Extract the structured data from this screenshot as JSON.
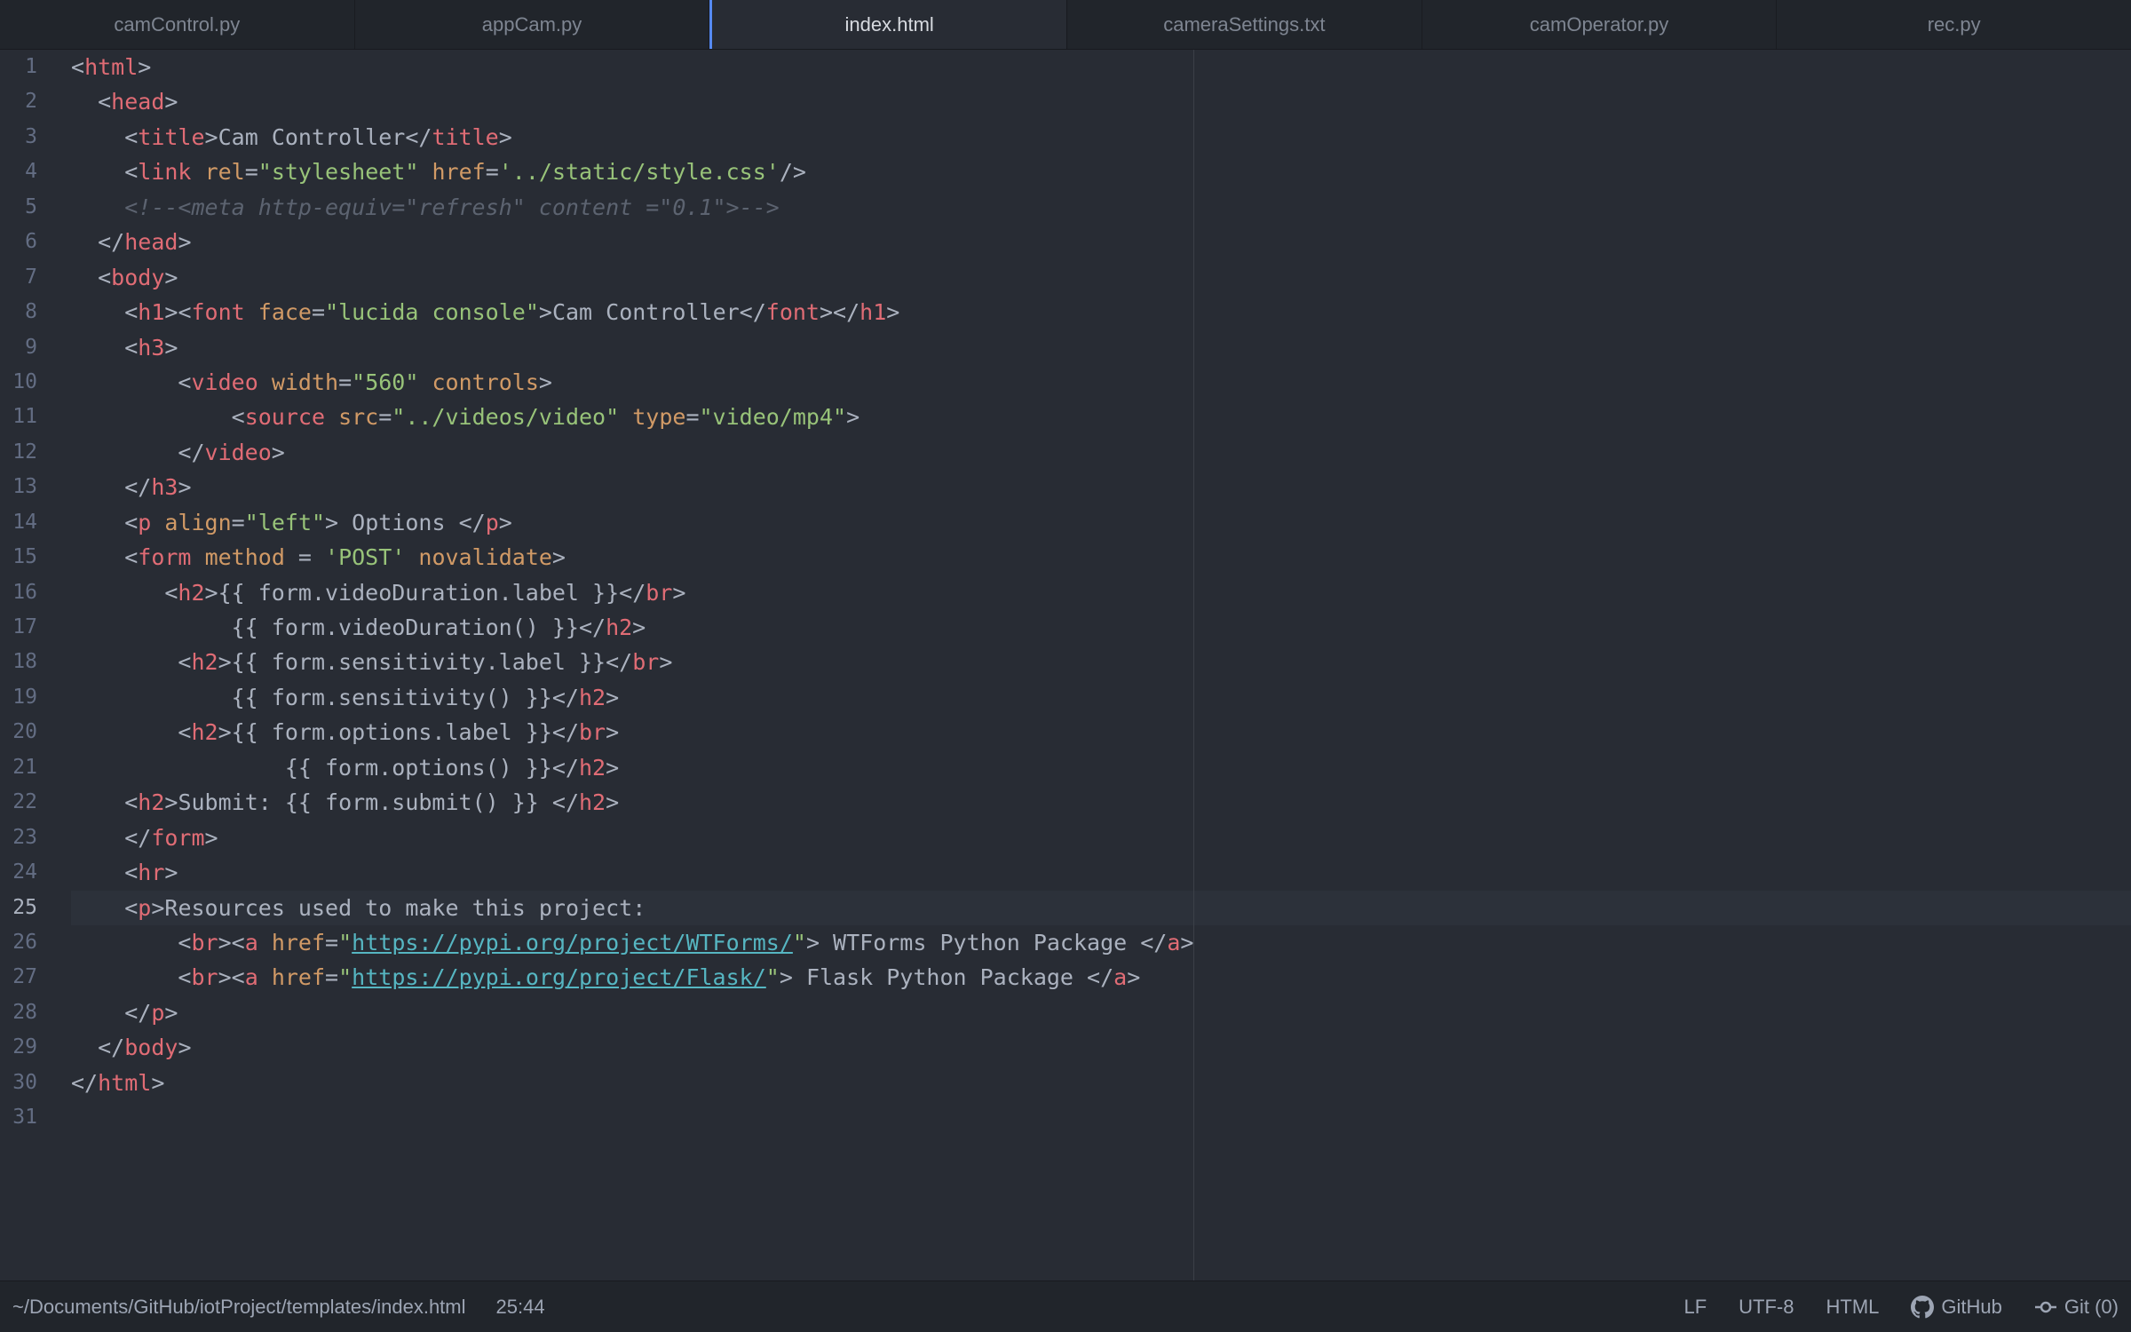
{
  "tabs": [
    {
      "label": "camControl.py",
      "active": false
    },
    {
      "label": "appCam.py",
      "active": false
    },
    {
      "label": "index.html",
      "active": true
    },
    {
      "label": "cameraSettings.txt",
      "active": false
    },
    {
      "label": "camOperator.py",
      "active": false
    },
    {
      "label": "rec.py",
      "active": false
    }
  ],
  "editor": {
    "current_line": 25,
    "lines": [
      [
        [
          "pun",
          "<"
        ],
        [
          "tag",
          "html"
        ],
        [
          "pun",
          ">"
        ]
      ],
      [
        [
          "txt",
          "  "
        ],
        [
          "pun",
          "<"
        ],
        [
          "tag",
          "head"
        ],
        [
          "pun",
          ">"
        ]
      ],
      [
        [
          "txt",
          "    "
        ],
        [
          "pun",
          "<"
        ],
        [
          "tag",
          "title"
        ],
        [
          "pun",
          ">"
        ],
        [
          "txt",
          "Cam Controller"
        ],
        [
          "pun",
          "</"
        ],
        [
          "tag",
          "title"
        ],
        [
          "pun",
          ">"
        ]
      ],
      [
        [
          "txt",
          "    "
        ],
        [
          "pun",
          "<"
        ],
        [
          "tag",
          "link"
        ],
        [
          "txt",
          " "
        ],
        [
          "att",
          "rel"
        ],
        [
          "pun",
          "="
        ],
        [
          "str",
          "\"stylesheet\""
        ],
        [
          "txt",
          " "
        ],
        [
          "att",
          "href"
        ],
        [
          "pun",
          "="
        ],
        [
          "str",
          "'../static/style.css'"
        ],
        [
          "pun",
          "/>"
        ]
      ],
      [
        [
          "txt",
          "    "
        ],
        [
          "cmt",
          "<!--<meta http-equiv=\"refresh\" content =\"0.1\">-->"
        ]
      ],
      [
        [
          "txt",
          "  "
        ],
        [
          "pun",
          "</"
        ],
        [
          "tag",
          "head"
        ],
        [
          "pun",
          ">"
        ]
      ],
      [
        [
          "txt",
          "  "
        ],
        [
          "pun",
          "<"
        ],
        [
          "tag",
          "body"
        ],
        [
          "pun",
          ">"
        ]
      ],
      [
        [
          "txt",
          "    "
        ],
        [
          "pun",
          "<"
        ],
        [
          "tag",
          "h1"
        ],
        [
          "pun",
          "><"
        ],
        [
          "tag",
          "font"
        ],
        [
          "txt",
          " "
        ],
        [
          "att",
          "face"
        ],
        [
          "pun",
          "="
        ],
        [
          "str",
          "\"lucida console\""
        ],
        [
          "pun",
          ">"
        ],
        [
          "txt",
          "Cam Controller"
        ],
        [
          "pun",
          "</"
        ],
        [
          "tag",
          "font"
        ],
        [
          "pun",
          "></"
        ],
        [
          "tag",
          "h1"
        ],
        [
          "pun",
          ">"
        ]
      ],
      [
        [
          "txt",
          "    "
        ],
        [
          "pun",
          "<"
        ],
        [
          "tag",
          "h3"
        ],
        [
          "pun",
          ">"
        ]
      ],
      [
        [
          "txt",
          "        "
        ],
        [
          "pun",
          "<"
        ],
        [
          "tag",
          "video"
        ],
        [
          "txt",
          " "
        ],
        [
          "att",
          "width"
        ],
        [
          "pun",
          "="
        ],
        [
          "str",
          "\"560\""
        ],
        [
          "txt",
          " "
        ],
        [
          "att",
          "controls"
        ],
        [
          "pun",
          ">"
        ]
      ],
      [
        [
          "txt",
          "            "
        ],
        [
          "pun",
          "<"
        ],
        [
          "tag",
          "source"
        ],
        [
          "txt",
          " "
        ],
        [
          "att",
          "src"
        ],
        [
          "pun",
          "="
        ],
        [
          "str",
          "\"../videos/video\""
        ],
        [
          "txt",
          " "
        ],
        [
          "att",
          "type"
        ],
        [
          "pun",
          "="
        ],
        [
          "str",
          "\"video/mp4\""
        ],
        [
          "pun",
          ">"
        ]
      ],
      [
        [
          "txt",
          "        "
        ],
        [
          "pun",
          "</"
        ],
        [
          "tag",
          "video"
        ],
        [
          "pun",
          ">"
        ]
      ],
      [
        [
          "txt",
          "    "
        ],
        [
          "pun",
          "</"
        ],
        [
          "tag",
          "h3"
        ],
        [
          "pun",
          ">"
        ]
      ],
      [
        [
          "txt",
          "    "
        ],
        [
          "pun",
          "<"
        ],
        [
          "tag",
          "p"
        ],
        [
          "txt",
          " "
        ],
        [
          "att",
          "align"
        ],
        [
          "pun",
          "="
        ],
        [
          "str",
          "\"left\""
        ],
        [
          "pun",
          ">"
        ],
        [
          "txt",
          " Options "
        ],
        [
          "pun",
          "</"
        ],
        [
          "tag",
          "p"
        ],
        [
          "pun",
          ">"
        ]
      ],
      [
        [
          "txt",
          "    "
        ],
        [
          "pun",
          "<"
        ],
        [
          "tag",
          "form"
        ],
        [
          "txt",
          " "
        ],
        [
          "att",
          "method"
        ],
        [
          "txt",
          " = "
        ],
        [
          "str",
          "'POST'"
        ],
        [
          "txt",
          " "
        ],
        [
          "att",
          "novalidate"
        ],
        [
          "pun",
          ">"
        ]
      ],
      [
        [
          "txt",
          "       "
        ],
        [
          "pun",
          "<"
        ],
        [
          "tag",
          "h2"
        ],
        [
          "pun",
          ">"
        ],
        [
          "txt",
          "{{ form.videoDuration.label }}"
        ],
        [
          "pun",
          "</"
        ],
        [
          "tag",
          "br"
        ],
        [
          "pun",
          ">"
        ]
      ],
      [
        [
          "txt",
          "            {{ form.videoDuration() }}"
        ],
        [
          "pun",
          "</"
        ],
        [
          "tag",
          "h2"
        ],
        [
          "pun",
          ">"
        ]
      ],
      [
        [
          "txt",
          "        "
        ],
        [
          "pun",
          "<"
        ],
        [
          "tag",
          "h2"
        ],
        [
          "pun",
          ">"
        ],
        [
          "txt",
          "{{ form.sensitivity.label }}"
        ],
        [
          "pun",
          "</"
        ],
        [
          "tag",
          "br"
        ],
        [
          "pun",
          ">"
        ]
      ],
      [
        [
          "txt",
          "            {{ form.sensitivity() }}"
        ],
        [
          "pun",
          "</"
        ],
        [
          "tag",
          "h2"
        ],
        [
          "pun",
          ">"
        ]
      ],
      [
        [
          "txt",
          "        "
        ],
        [
          "pun",
          "<"
        ],
        [
          "tag",
          "h2"
        ],
        [
          "pun",
          ">"
        ],
        [
          "txt",
          "{{ form.options.label }}"
        ],
        [
          "pun",
          "</"
        ],
        [
          "tag",
          "br"
        ],
        [
          "pun",
          ">"
        ]
      ],
      [
        [
          "txt",
          "                {{ form.options() }}"
        ],
        [
          "pun",
          "</"
        ],
        [
          "tag",
          "h2"
        ],
        [
          "pun",
          ">"
        ]
      ],
      [
        [
          "txt",
          "    "
        ],
        [
          "pun",
          "<"
        ],
        [
          "tag",
          "h2"
        ],
        [
          "pun",
          ">"
        ],
        [
          "txt",
          "Submit: {{ form.submit() }} "
        ],
        [
          "pun",
          "</"
        ],
        [
          "tag",
          "h2"
        ],
        [
          "pun",
          ">"
        ]
      ],
      [
        [
          "txt",
          "    "
        ],
        [
          "pun",
          "</"
        ],
        [
          "tag",
          "form"
        ],
        [
          "pun",
          ">"
        ]
      ],
      [
        [
          "txt",
          "    "
        ],
        [
          "pun",
          "<"
        ],
        [
          "tag",
          "hr"
        ],
        [
          "pun",
          ">"
        ]
      ],
      [
        [
          "txt",
          "    "
        ],
        [
          "pun",
          "<"
        ],
        [
          "tag",
          "p"
        ],
        [
          "pun",
          ">"
        ],
        [
          "txt",
          "Resources used to make this project:"
        ]
      ],
      [
        [
          "txt",
          "        "
        ],
        [
          "pun",
          "<"
        ],
        [
          "tag",
          "br"
        ],
        [
          "pun",
          "><"
        ],
        [
          "tag",
          "a"
        ],
        [
          "txt",
          " "
        ],
        [
          "att",
          "href"
        ],
        [
          "pun",
          "="
        ],
        [
          "str",
          "\""
        ],
        [
          "url",
          "https://pypi.org/project/WTForms/"
        ],
        [
          "str",
          "\""
        ],
        [
          "pun",
          ">"
        ],
        [
          "txt",
          " WTForms Python Package "
        ],
        [
          "pun",
          "</"
        ],
        [
          "tag",
          "a"
        ],
        [
          "pun",
          ">"
        ]
      ],
      [
        [
          "txt",
          "        "
        ],
        [
          "pun",
          "<"
        ],
        [
          "tag",
          "br"
        ],
        [
          "pun",
          "><"
        ],
        [
          "tag",
          "a"
        ],
        [
          "txt",
          " "
        ],
        [
          "att",
          "href"
        ],
        [
          "pun",
          "="
        ],
        [
          "str",
          "\""
        ],
        [
          "url",
          "https://pypi.org/project/Flask/"
        ],
        [
          "str",
          "\""
        ],
        [
          "pun",
          ">"
        ],
        [
          "txt",
          " Flask Python Package "
        ],
        [
          "pun",
          "</"
        ],
        [
          "tag",
          "a"
        ],
        [
          "pun",
          ">"
        ]
      ],
      [
        [
          "txt",
          "    "
        ],
        [
          "pun",
          "</"
        ],
        [
          "tag",
          "p"
        ],
        [
          "pun",
          ">"
        ]
      ],
      [
        [
          "txt",
          "  "
        ],
        [
          "pun",
          "</"
        ],
        [
          "tag",
          "body"
        ],
        [
          "pun",
          ">"
        ]
      ],
      [
        [
          "pun",
          "</"
        ],
        [
          "tag",
          "html"
        ],
        [
          "pun",
          ">"
        ]
      ],
      []
    ]
  },
  "status": {
    "file_path": "~/Documents/GitHub/iotProject/templates/index.html",
    "cursor_position": "25:44",
    "line_ending": "LF",
    "encoding": "UTF-8",
    "grammar": "HTML",
    "github_label": "GitHub",
    "github_icon": "github-icon",
    "git_label": "Git (0)",
    "git_icon": "git-commit-icon"
  }
}
